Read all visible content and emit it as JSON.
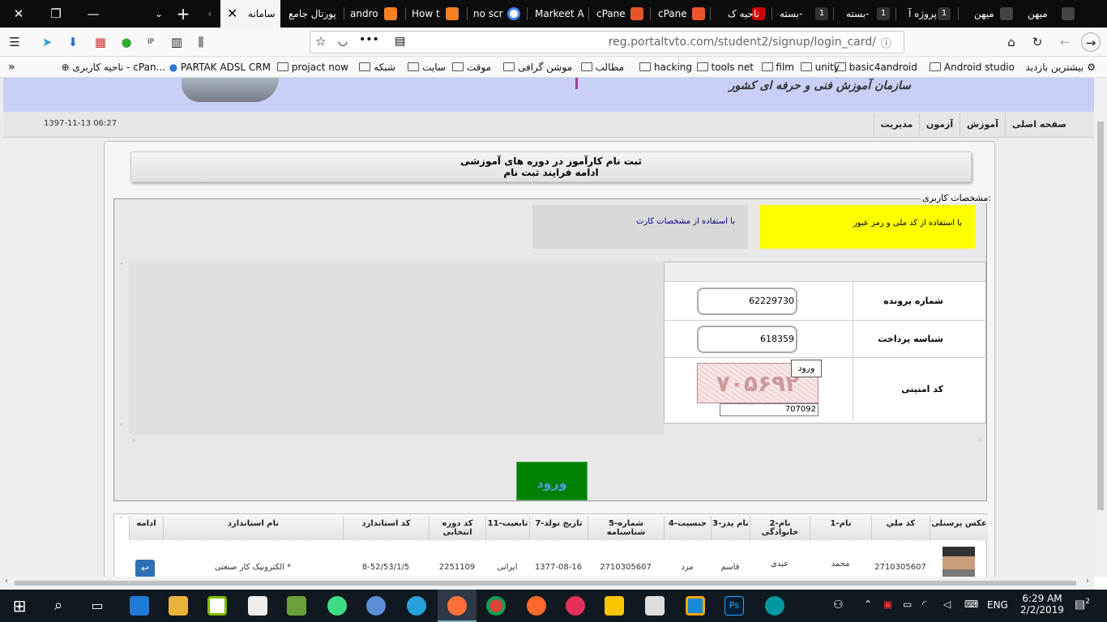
{
  "browser": {
    "tabs": [
      {
        "title": "میهن",
        "icon": "tab-favicon"
      },
      {
        "title": "میهن",
        "icon": "tab-favicon"
      },
      {
        "title": "پروژه آ",
        "icon": "tab-favicon"
      },
      {
        "title": "بسته-",
        "icon": "tab-favicon"
      },
      {
        "title": "بسته-",
        "icon": "tab-favicon"
      },
      {
        "title": "ناحیه ک",
        "icon": "tab-favicon"
      },
      {
        "title": "cPane",
        "icon": "cpanel-icon"
      },
      {
        "title": "cPane",
        "icon": "cpanel-icon"
      },
      {
        "title": "Markeet A",
        "icon": "tab-favicon"
      },
      {
        "title": "no scr",
        "icon": "google-icon"
      },
      {
        "title": "How t",
        "icon": "stackoverflow-icon"
      },
      {
        "title": "andro",
        "icon": "stackoverflow-icon"
      },
      {
        "title": "پورتال جامع",
        "icon": "tab-favicon"
      },
      {
        "title": "سامانه",
        "icon": "tab-favicon",
        "active": true
      }
    ],
    "url": "reg.portaltvto.com/student2/signup/login_card/",
    "bookmarks": [
      {
        "label": "بیشترین بازدید"
      },
      {
        "label": "Android studio"
      },
      {
        "label": "basic4android"
      },
      {
        "label": "unity"
      },
      {
        "label": "film"
      },
      {
        "label": "tools net"
      },
      {
        "label": "hacking"
      },
      {
        "label": "مطالب"
      },
      {
        "label": "موشن گرافی"
      },
      {
        "label": "موقت"
      },
      {
        "label": "سایت"
      },
      {
        "label": "شبکه"
      },
      {
        "label": "projact now"
      },
      {
        "label": "PARTAK ADSL CRM"
      },
      {
        "label": "ناحیه کاربری - cPan..."
      }
    ]
  },
  "site": {
    "org_name": "سازمان آموزش فنی و حرفه ای کشور",
    "menu": [
      "صفحه اصلی",
      "آموزش",
      "آزمون",
      "مدیریت"
    ],
    "datetime": "1397-11-13 06:27",
    "title_line1": "ثبت نام کارآموز در دوره های آموزشی",
    "title_line2": "ادامه فرایند ثبت نام",
    "section_legend": "مشخصات کاربری:",
    "option_national_code": "با استفاده از کد ملی و رمز عبور",
    "option_card": "با استفاده از مشخصات کارت",
    "form": {
      "file_number_label": "شماره پرونده",
      "file_number_value": "62229730",
      "payment_id_label": "شناسه پرداخت",
      "payment_id_value": "618359",
      "security_code_label": "کد امنیتی",
      "captcha_text": "۷۰۵۶۹۲",
      "captcha_input_value": "707092",
      "captcha_tooltip": "ورود"
    },
    "submit_label": "ورود",
    "grid": {
      "headers": [
        "عکس پرسنلی",
        "کد ملي",
        "1-نام",
        "2-نام خانوادگی",
        "3-نام پدر",
        "4-جنسیت",
        "5-شماره شناسنامه",
        "7-تاریخ تولد",
        "11-تابعیت",
        "کد دوره انتخابی",
        "کد استاندارد",
        "نام استاندارد",
        "ادامه"
      ],
      "row": [
        "",
        "2710305607",
        "محمد",
        "عبدی",
        "قاسم",
        "مرد",
        "2710305607",
        "1377-08-16",
        "ایرانی",
        "2251109",
        "8-52/53/1/5",
        "الکترونیک کار صنعتی *",
        ""
      ]
    }
  },
  "taskbar": {
    "time": "6:29 AM",
    "date": "2/2/2019",
    "lang": "ENG",
    "notifications": "2"
  }
}
